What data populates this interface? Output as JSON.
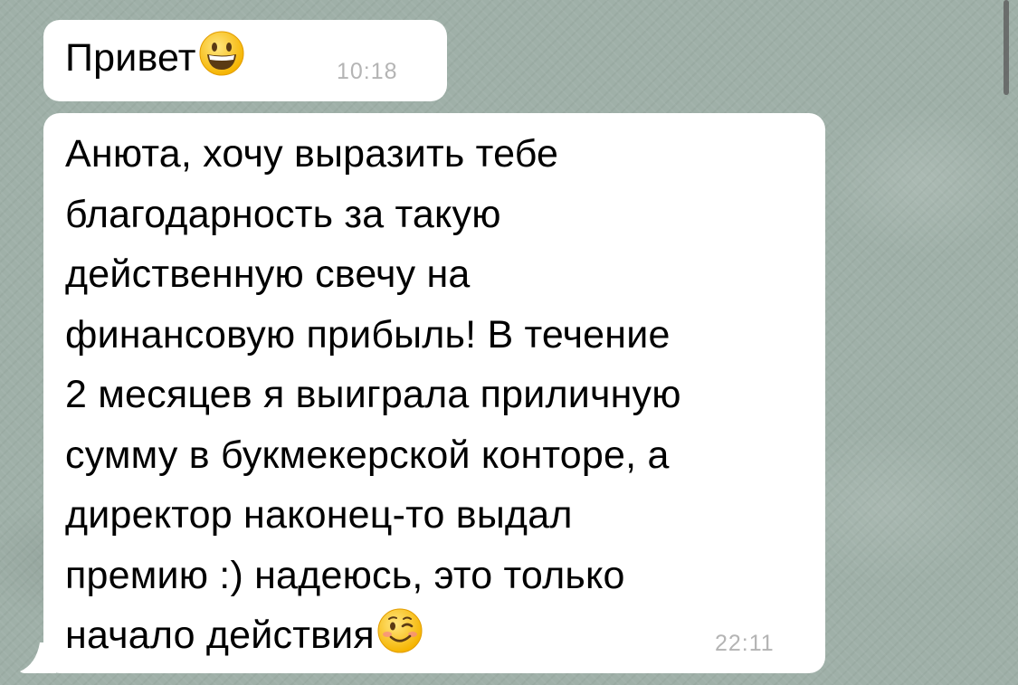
{
  "conversation": {
    "messages": [
      {
        "text": "Привет",
        "emoji": "grinning-face-emoji",
        "time": "10:18"
      },
      {
        "lines": [
          "Анюта, хочу выразить тебе",
          "благодарность за такую",
          "действенную свечу на",
          "финансовую прибыль! В течение",
          "2 месяцев я выиграла приличную",
          "сумму в букмекерской конторе, а",
          "директор наконец-то выдал",
          "премию :) надеюсь, это только",
          "начало действия"
        ],
        "emoji": "winking-face-emoji",
        "time": "22:11"
      }
    ]
  },
  "colors": {
    "background": "#9fb0a8",
    "bubble": "#ffffff",
    "timestamp": "#b4b4b4"
  }
}
